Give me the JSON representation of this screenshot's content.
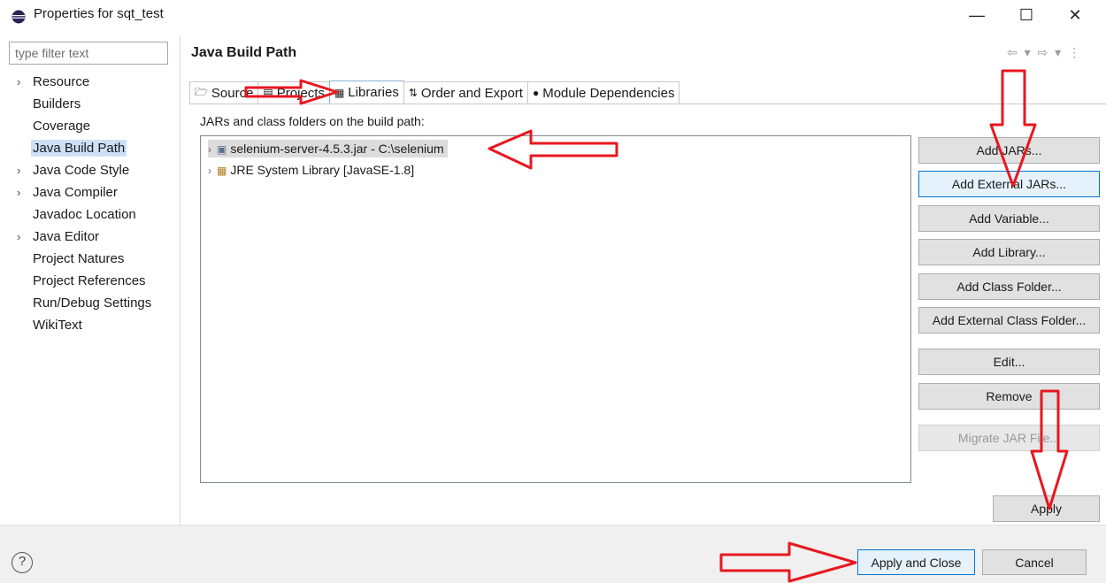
{
  "window": {
    "title": "Properties for sqt_test",
    "controls": {
      "minimize": "—",
      "maximize": "☐",
      "close": "✕"
    }
  },
  "filter": {
    "placeholder": "type filter text"
  },
  "nav": {
    "items": [
      {
        "label": "Resource",
        "expandable": true
      },
      {
        "label": "Builders",
        "expandable": false
      },
      {
        "label": "Coverage",
        "expandable": false
      },
      {
        "label": "Java Build Path",
        "expandable": false,
        "selected": true
      },
      {
        "label": "Java Code Style",
        "expandable": true
      },
      {
        "label": "Java Compiler",
        "expandable": true
      },
      {
        "label": "Javadoc Location",
        "expandable": false
      },
      {
        "label": "Java Editor",
        "expandable": true
      },
      {
        "label": "Project Natures",
        "expandable": false
      },
      {
        "label": "Project References",
        "expandable": false
      },
      {
        "label": "Run/Debug Settings",
        "expandable": false
      },
      {
        "label": "WikiText",
        "expandable": false
      }
    ]
  },
  "page": {
    "title": "Java Build Path",
    "nav_arrows": "⇦ ▾ ⇨ ▾ ⋮"
  },
  "tabs": [
    {
      "label": "Source",
      "icon": "source-folder-icon"
    },
    {
      "label": "Projects",
      "icon": "projects-icon"
    },
    {
      "label": "Libraries",
      "icon": "libraries-icon",
      "active": true
    },
    {
      "label": "Order and Export",
      "icon": "order-export-icon"
    },
    {
      "label": "Module Dependencies",
      "icon": "module-dependencies-icon"
    }
  ],
  "libraries": {
    "heading": "JARs and class folders on the build path:",
    "entries": [
      {
        "label": "selenium-server-4.5.3.jar - C:\\selenium",
        "icon": "jar-icon",
        "selected": true
      },
      {
        "label": "JRE System Library [JavaSE-1.8]",
        "icon": "library-icon",
        "selected": false
      }
    ]
  },
  "buttons": {
    "add_jars": "Add JARs...",
    "add_external_jars": "Add External JARs...",
    "add_variable": "Add Variable...",
    "add_library": "Add Library...",
    "add_class_folder": "Add Class Folder...",
    "add_external_class_folder": "Add External Class Folder...",
    "edit": "Edit...",
    "remove": "Remove",
    "migrate_jar": "Migrate JAR File...",
    "apply": "Apply",
    "apply_and_close": "Apply and Close",
    "cancel": "Cancel",
    "help": "?"
  },
  "colors": {
    "annotation_arrow": "#e8171f",
    "selection": "#cce0f7",
    "focus_border": "#0078d7"
  }
}
